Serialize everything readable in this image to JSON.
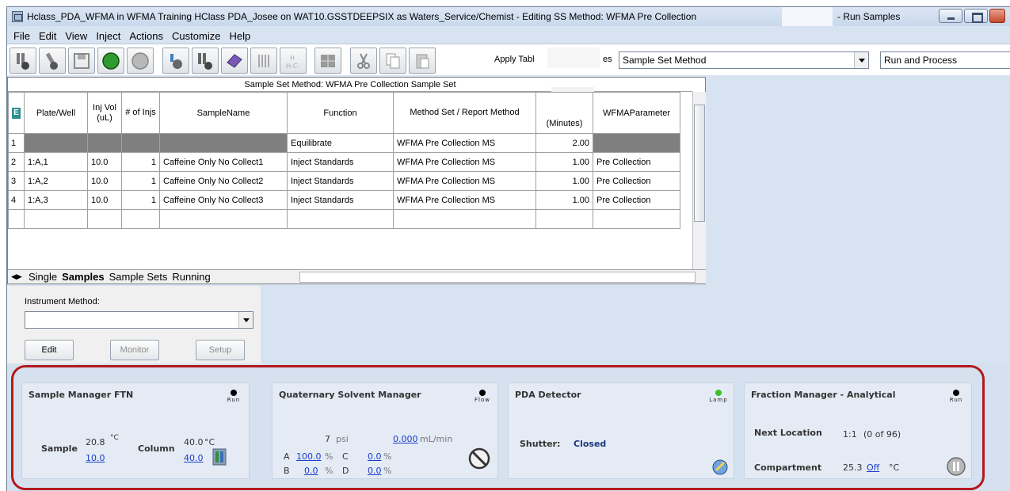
{
  "window": {
    "title": "Hclass_PDA_WFMA in WFMA Training HClass PDA_Josee on WAT10.GSSTDEEPSIX as Waters_Service/Chemist - Editing SS Method: WFMA Pre Collection",
    "title_suffix": "- Run Samples"
  },
  "menu": [
    "File",
    "Edit",
    "View",
    "Inject",
    "Actions",
    "Customize",
    "Help"
  ],
  "toolbar": {
    "icons": [
      "inject-vial-icon",
      "alter-sample-icon",
      "save-icon",
      "start-run-icon",
      "stop-run-icon",
      "prepare-icon",
      "vial-pair-icon",
      "plate-icon",
      "columns-icon",
      "hc-icon",
      "grid-icon",
      "cut-icon",
      "copy-icon",
      "paste-icon"
    ],
    "apply_table_label": "Apply Tabl",
    "apply_table_tail": "es",
    "method_select": "Sample Set Method",
    "run_select": "Run and Process"
  },
  "grid": {
    "caption": "Sample Set Method: WFMA Pre Collection Sample Set",
    "columns": [
      "Plate/Well",
      "Inj Vol (uL)",
      "# of Injs",
      "SampleName",
      "Function",
      "Method Set / Report Method",
      "(Minutes)",
      "WFMAParameter"
    ],
    "rows": [
      {
        "n": "1",
        "plate": "",
        "vol": "",
        "injs": "",
        "name": "",
        "func": "Equilibrate",
        "method": "WFMA Pre Collection MS",
        "time": "2.00",
        "param": ""
      },
      {
        "n": "2",
        "plate": "1:A,1",
        "vol": "10.0",
        "injs": "1",
        "name": "Caffeine Only No Collect1",
        "func": "Inject Standards",
        "method": "WFMA Pre Collection MS",
        "time": "1.00",
        "param": "Pre Collection"
      },
      {
        "n": "3",
        "plate": "1:A,2",
        "vol": "10.0",
        "injs": "1",
        "name": "Caffeine Only No Collect2",
        "func": "Inject Standards",
        "method": "WFMA Pre Collection MS",
        "time": "1.00",
        "param": "Pre Collection"
      },
      {
        "n": "4",
        "plate": "1:A,3",
        "vol": "10.0",
        "injs": "1",
        "name": "Caffeine Only No Collect3",
        "func": "Inject Standards",
        "method": "WFMA Pre Collection MS",
        "time": "1.00",
        "param": "Pre Collection"
      }
    ],
    "tabs": [
      "Single",
      "Samples",
      "Sample Sets",
      "Running"
    ],
    "active_tab": "Samples"
  },
  "method_panel": {
    "label": "Instrument Method:",
    "value": "",
    "buttons": {
      "edit": "Edit",
      "monitor": "Monitor",
      "setup": "Setup"
    }
  },
  "sample_manager": {
    "title": "Sample Manager FTN",
    "indicator": "Run",
    "sample_label": "Sample",
    "sample_temp": "20.8",
    "sample_set": "10.0",
    "column_label": "Column",
    "column_temp": "40.0",
    "column_set": "40.0",
    "unit": "°C"
  },
  "qsm": {
    "title": "Quaternary Solvent Manager",
    "indicator": "Flow",
    "pressure": "7",
    "pressure_unit": "psi",
    "flow": "0.000",
    "flow_unit": "mL/min",
    "a_label": "A",
    "a_value": "100.0",
    "b_label": "B",
    "b_value": "0.0",
    "c_label": "C",
    "c_value": "0.0",
    "d_label": "D",
    "d_value": "0.0",
    "pct": "%"
  },
  "pda": {
    "title": "PDA Detector",
    "indicator": "Lamp",
    "shutter_label": "Shutter:",
    "shutter_value": "Closed"
  },
  "fraction": {
    "title": "Fraction Manager - Analytical",
    "indicator": "Run",
    "next_label": "Next Location",
    "next_value": "1:1",
    "next_count": "(0 of 96)",
    "comp_label": "Compartment",
    "comp_value": "25.3",
    "comp_state": "Off",
    "unit": "°C"
  }
}
